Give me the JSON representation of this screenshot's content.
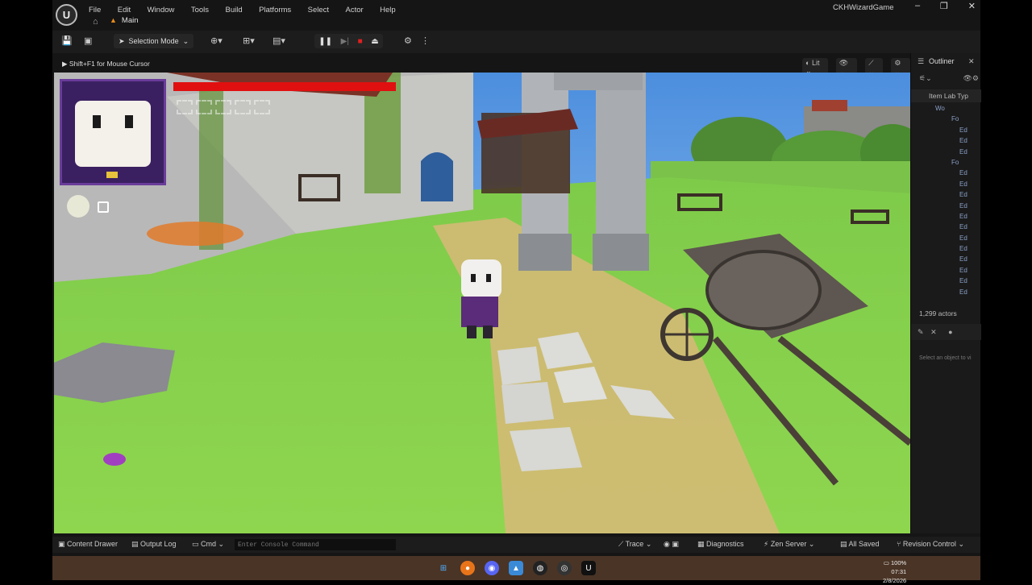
{
  "menubar": {
    "logo": "ue-logo",
    "items": [
      "File",
      "Edit",
      "Window",
      "Tools",
      "Build",
      "Platforms",
      "Select",
      "Actor",
      "Help"
    ],
    "tab_label": "Main",
    "project_name": "CKHWizardGame"
  },
  "toolbar": {
    "selection_mode": "Selection Mode"
  },
  "viewport_header": {
    "hint": "Shift+F1 for Mouse Cursor",
    "lit_label": "Lit"
  },
  "game_hud": {
    "health_fill": 1.0,
    "health_color": "#e01010",
    "portrait_bg": "#3a2060"
  },
  "outliner": {
    "title": "Outliner",
    "column_header": "Item Lab Typ",
    "rows": [
      "Wo",
      "Fo",
      "Ed",
      "Ed",
      "Ed",
      "Fo",
      "Ed",
      "Ed",
      "Ed",
      "Ed",
      "Ed",
      "Ed",
      "Ed",
      "Ed",
      "Ed",
      "Ed",
      "Ed",
      "Ed"
    ],
    "actor_count": "1,299 actors",
    "details_hint": "Select an object to vi"
  },
  "statusbar": {
    "content_drawer": "Content Drawer",
    "output_log": "Output Log",
    "cmd": "Cmd",
    "console_placeholder": "Enter Console Command",
    "trace": "Trace",
    "diagnostics": "Diagnostics",
    "zen_server": "Zen Server",
    "all_saved": "All Saved",
    "revision_control": "Revision Control"
  },
  "tray": {
    "battery": "100%",
    "time": "07:31",
    "date": "2/8/2026"
  }
}
